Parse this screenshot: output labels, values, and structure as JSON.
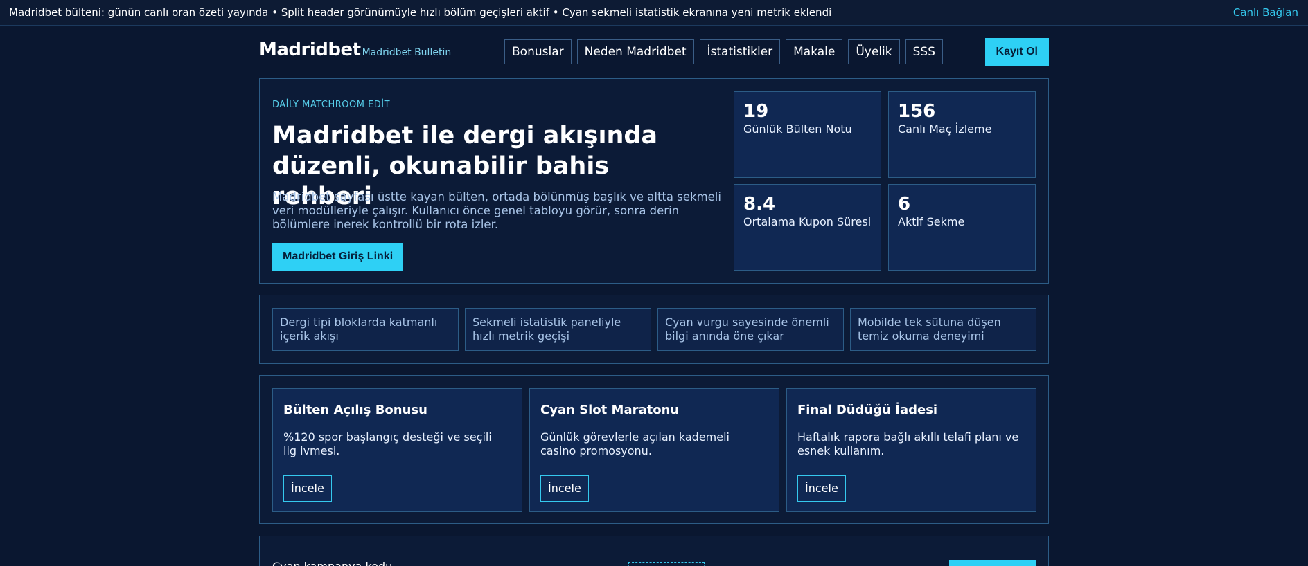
{
  "ticker": {
    "text": "Madridbet bülteni: günün canlı oran özeti yayında • Split header görünümüyle hızlı bölüm geçişleri aktif • Cyan sekmeli istatistik ekranına yeni metrik eklendi",
    "link": "Canlı Bağlan"
  },
  "header": {
    "brand": "Madridbet",
    "brand_sub": "Madridbet Bulletin",
    "nav": [
      "Bonuslar",
      "Neden Madridbet",
      "İstatistikler",
      "Makale",
      "Üyelik",
      "SSS"
    ],
    "cta": "Kayıt Ol"
  },
  "hero": {
    "eyebrow": "DAİLY MATCHROOM EDİT",
    "title": "Madridbet ile dergi akışında düzenli, okunabilir bahis rehberi",
    "description": "Madridbet sayfası üstte kayan bülten, ortada bölünmüş başlık ve altta sekmeli veri modülleriyle çalışır. Kullanıcı önce genel tabloyu görür, sonra derin bölümlere inerek kontrollü bir rota izler.",
    "cta": "Madridbet Giriş Linki",
    "stats": [
      {
        "value": "19",
        "label": "Günlük Bülten Notu"
      },
      {
        "value": "156",
        "label": "Canlı Maç İzleme"
      },
      {
        "value": "8.4",
        "label": "Ortalama Kupon Süresi"
      },
      {
        "value": "6",
        "label": "Aktif Sekme"
      }
    ]
  },
  "features": [
    "Dergi tipi bloklarda katmanlı içerik akışı",
    "Sekmeli istatistik paneliyle hızlı metrik geçişi",
    "Cyan vurgu sayesinde önemli bilgi anında öne çıkar",
    "Mobilde tek sütuna düşen temiz okuma deneyimi"
  ],
  "promos": [
    {
      "title": "Bülten Açılış Bonusu",
      "description": "%120 spor başlangıç desteği ve seçili lig ivmesi.",
      "button": "İncele"
    },
    {
      "title": "Cyan Slot Maratonu",
      "description": "Günlük görevlerle açılan kademeli casino promosyonu.",
      "button": "İncele"
    },
    {
      "title": "Final Düdüğü İadesi",
      "description": "Haftalık rapora bağlı akıllı telafi planı ve esnek kullanım.",
      "button": "İncele"
    }
  ],
  "campaign": {
    "label": "Cyan kampanya kodu"
  },
  "colors": {
    "background": "#0a1730",
    "accent": "#2ed0f5",
    "border": "#2c5c86",
    "card": "#102853"
  }
}
